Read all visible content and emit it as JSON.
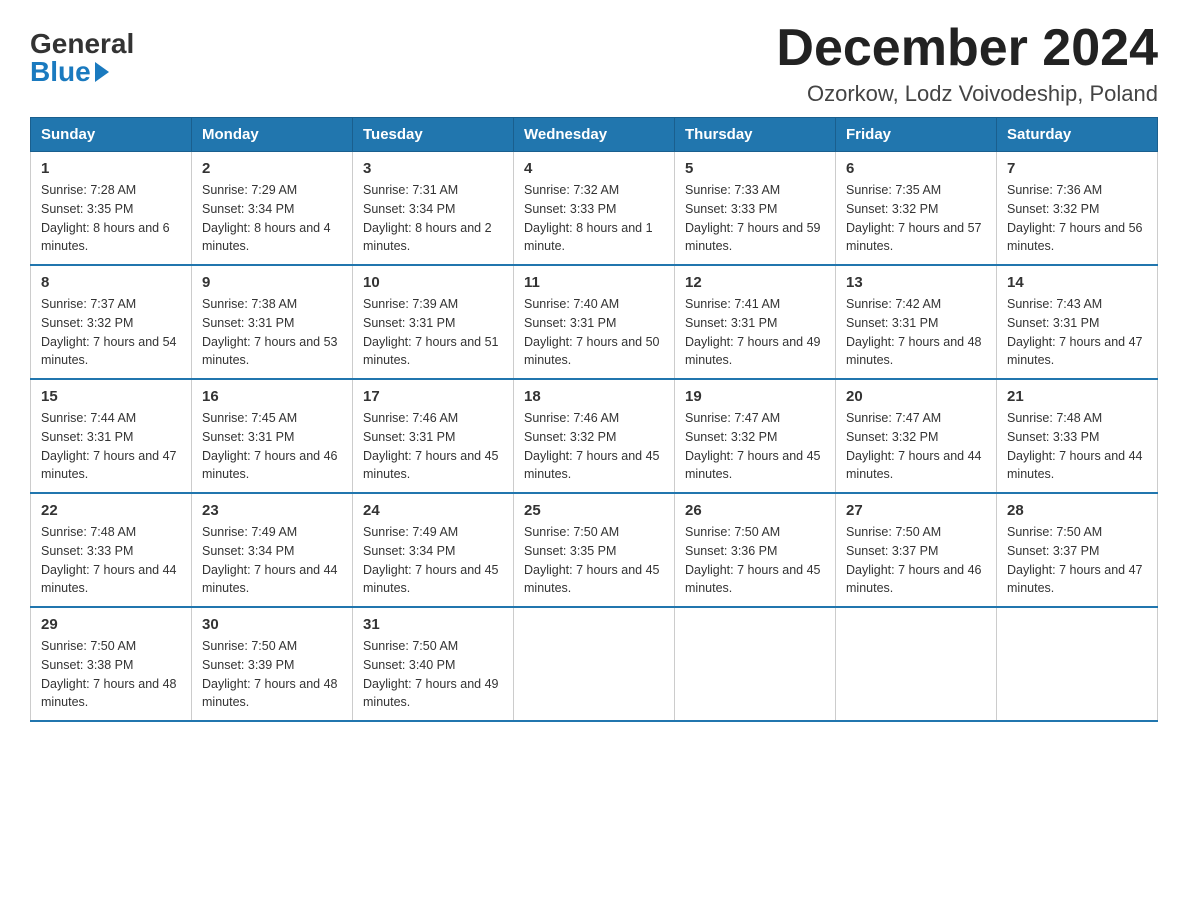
{
  "logo": {
    "general": "General",
    "blue": "Blue"
  },
  "title": "December 2024",
  "location": "Ozorkow, Lodz Voivodeship, Poland",
  "headers": [
    "Sunday",
    "Monday",
    "Tuesday",
    "Wednesday",
    "Thursday",
    "Friday",
    "Saturday"
  ],
  "weeks": [
    [
      {
        "day": "1",
        "sunrise": "7:28 AM",
        "sunset": "3:35 PM",
        "daylight": "8 hours and 6 minutes."
      },
      {
        "day": "2",
        "sunrise": "7:29 AM",
        "sunset": "3:34 PM",
        "daylight": "8 hours and 4 minutes."
      },
      {
        "day": "3",
        "sunrise": "7:31 AM",
        "sunset": "3:34 PM",
        "daylight": "8 hours and 2 minutes."
      },
      {
        "day": "4",
        "sunrise": "7:32 AM",
        "sunset": "3:33 PM",
        "daylight": "8 hours and 1 minute."
      },
      {
        "day": "5",
        "sunrise": "7:33 AM",
        "sunset": "3:33 PM",
        "daylight": "7 hours and 59 minutes."
      },
      {
        "day": "6",
        "sunrise": "7:35 AM",
        "sunset": "3:32 PM",
        "daylight": "7 hours and 57 minutes."
      },
      {
        "day": "7",
        "sunrise": "7:36 AM",
        "sunset": "3:32 PM",
        "daylight": "7 hours and 56 minutes."
      }
    ],
    [
      {
        "day": "8",
        "sunrise": "7:37 AM",
        "sunset": "3:32 PM",
        "daylight": "7 hours and 54 minutes."
      },
      {
        "day": "9",
        "sunrise": "7:38 AM",
        "sunset": "3:31 PM",
        "daylight": "7 hours and 53 minutes."
      },
      {
        "day": "10",
        "sunrise": "7:39 AM",
        "sunset": "3:31 PM",
        "daylight": "7 hours and 51 minutes."
      },
      {
        "day": "11",
        "sunrise": "7:40 AM",
        "sunset": "3:31 PM",
        "daylight": "7 hours and 50 minutes."
      },
      {
        "day": "12",
        "sunrise": "7:41 AM",
        "sunset": "3:31 PM",
        "daylight": "7 hours and 49 minutes."
      },
      {
        "day": "13",
        "sunrise": "7:42 AM",
        "sunset": "3:31 PM",
        "daylight": "7 hours and 48 minutes."
      },
      {
        "day": "14",
        "sunrise": "7:43 AM",
        "sunset": "3:31 PM",
        "daylight": "7 hours and 47 minutes."
      }
    ],
    [
      {
        "day": "15",
        "sunrise": "7:44 AM",
        "sunset": "3:31 PM",
        "daylight": "7 hours and 47 minutes."
      },
      {
        "day": "16",
        "sunrise": "7:45 AM",
        "sunset": "3:31 PM",
        "daylight": "7 hours and 46 minutes."
      },
      {
        "day": "17",
        "sunrise": "7:46 AM",
        "sunset": "3:31 PM",
        "daylight": "7 hours and 45 minutes."
      },
      {
        "day": "18",
        "sunrise": "7:46 AM",
        "sunset": "3:32 PM",
        "daylight": "7 hours and 45 minutes."
      },
      {
        "day": "19",
        "sunrise": "7:47 AM",
        "sunset": "3:32 PM",
        "daylight": "7 hours and 45 minutes."
      },
      {
        "day": "20",
        "sunrise": "7:47 AM",
        "sunset": "3:32 PM",
        "daylight": "7 hours and 44 minutes."
      },
      {
        "day": "21",
        "sunrise": "7:48 AM",
        "sunset": "3:33 PM",
        "daylight": "7 hours and 44 minutes."
      }
    ],
    [
      {
        "day": "22",
        "sunrise": "7:48 AM",
        "sunset": "3:33 PM",
        "daylight": "7 hours and 44 minutes."
      },
      {
        "day": "23",
        "sunrise": "7:49 AM",
        "sunset": "3:34 PM",
        "daylight": "7 hours and 44 minutes."
      },
      {
        "day": "24",
        "sunrise": "7:49 AM",
        "sunset": "3:34 PM",
        "daylight": "7 hours and 45 minutes."
      },
      {
        "day": "25",
        "sunrise": "7:50 AM",
        "sunset": "3:35 PM",
        "daylight": "7 hours and 45 minutes."
      },
      {
        "day": "26",
        "sunrise": "7:50 AM",
        "sunset": "3:36 PM",
        "daylight": "7 hours and 45 minutes."
      },
      {
        "day": "27",
        "sunrise": "7:50 AM",
        "sunset": "3:37 PM",
        "daylight": "7 hours and 46 minutes."
      },
      {
        "day": "28",
        "sunrise": "7:50 AM",
        "sunset": "3:37 PM",
        "daylight": "7 hours and 47 minutes."
      }
    ],
    [
      {
        "day": "29",
        "sunrise": "7:50 AM",
        "sunset": "3:38 PM",
        "daylight": "7 hours and 48 minutes."
      },
      {
        "day": "30",
        "sunrise": "7:50 AM",
        "sunset": "3:39 PM",
        "daylight": "7 hours and 48 minutes."
      },
      {
        "day": "31",
        "sunrise": "7:50 AM",
        "sunset": "3:40 PM",
        "daylight": "7 hours and 49 minutes."
      },
      null,
      null,
      null,
      null
    ]
  ]
}
